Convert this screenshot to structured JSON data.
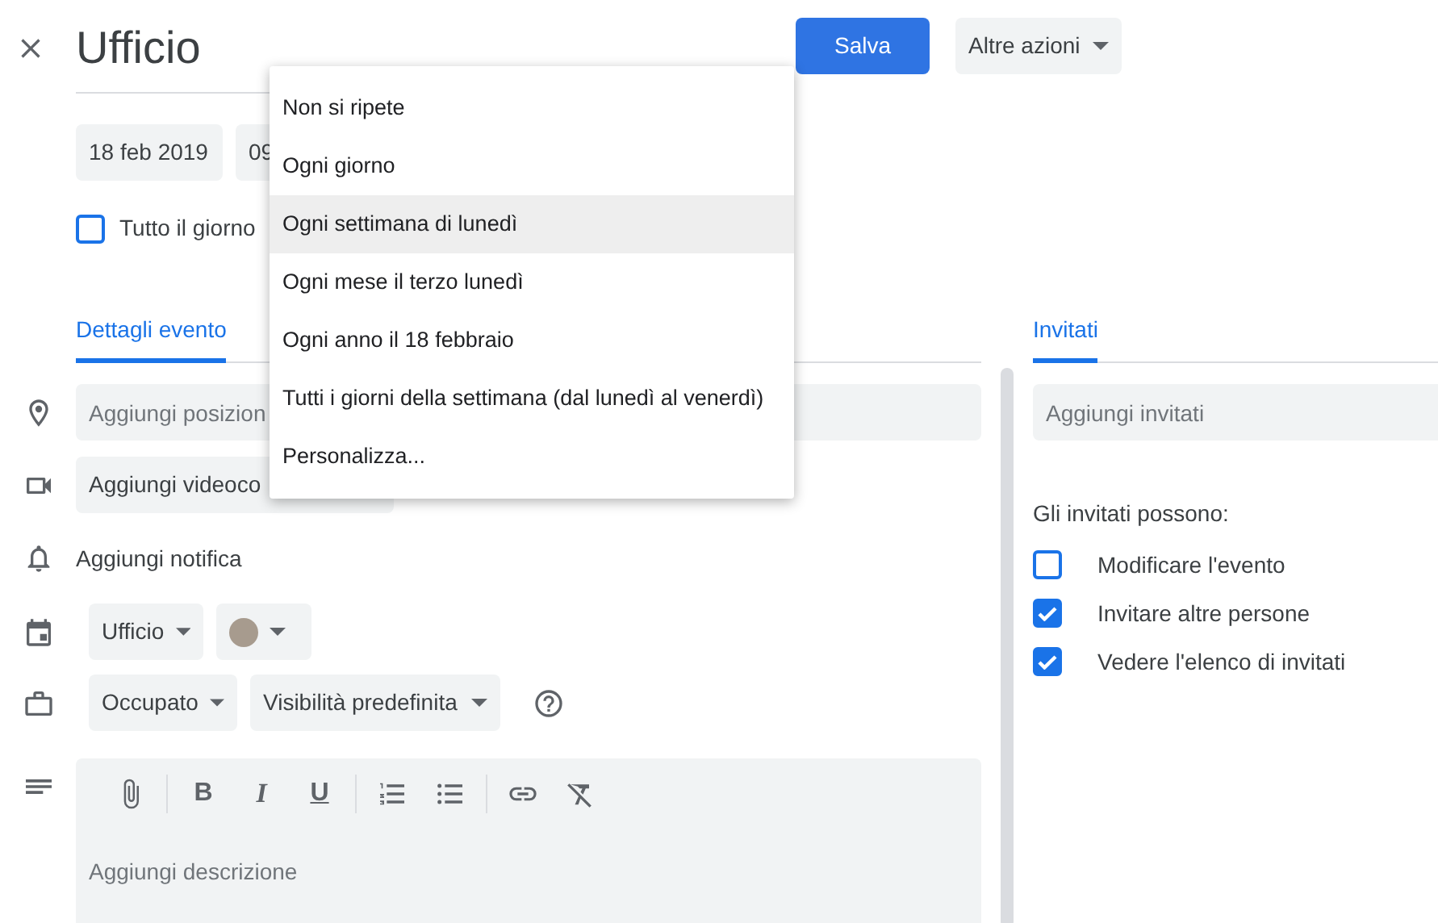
{
  "header": {
    "title": "Ufficio",
    "save_button": "Salva",
    "more_actions": "Altre azioni"
  },
  "date": "18 feb 2019",
  "time": "09",
  "all_day": {
    "label": "Tutto il giorno",
    "checked": false
  },
  "tabs": [
    {
      "label": "Dettagli evento",
      "selected": true
    }
  ],
  "location": {
    "placeholder": "Aggiungi posizion"
  },
  "video_button": "Aggiungi videoco",
  "notification": "Aggiungi notifica",
  "calendar": {
    "label": "Ufficio",
    "color": "#a79b8e"
  },
  "availability": "Occupato",
  "visibility": "Visibilità predefinita",
  "format_buttons": [
    "B",
    "I",
    "U"
  ],
  "description": {
    "placeholder": "Aggiungi descrizione"
  },
  "guests": {
    "tabs": [
      {
        "label": "Invitati",
        "selected": true
      }
    ],
    "placeholder": "Aggiungi invitati",
    "permissions_label": "Gli invitati possono:",
    "permissions": [
      {
        "label": "Modificare l'evento",
        "checked": false
      },
      {
        "label": "Invitare altre persone",
        "checked": true
      },
      {
        "label": "Vedere l'elenco di invitati",
        "checked": true
      }
    ]
  },
  "repeat_menu": [
    {
      "label": "Non si ripete",
      "selected": false
    },
    {
      "label": "Ogni giorno",
      "selected": false
    },
    {
      "label": "Ogni settimana di lunedì",
      "selected": true
    },
    {
      "label": "Ogni mese il terzo lunedì",
      "selected": false
    },
    {
      "label": "Ogni anno il 18 febbraio",
      "selected": false
    },
    {
      "label": "Tutti i giorni della settimana (dal lunedì al venerdì)",
      "selected": false
    },
    {
      "label": "Personalizza...",
      "selected": false
    }
  ]
}
